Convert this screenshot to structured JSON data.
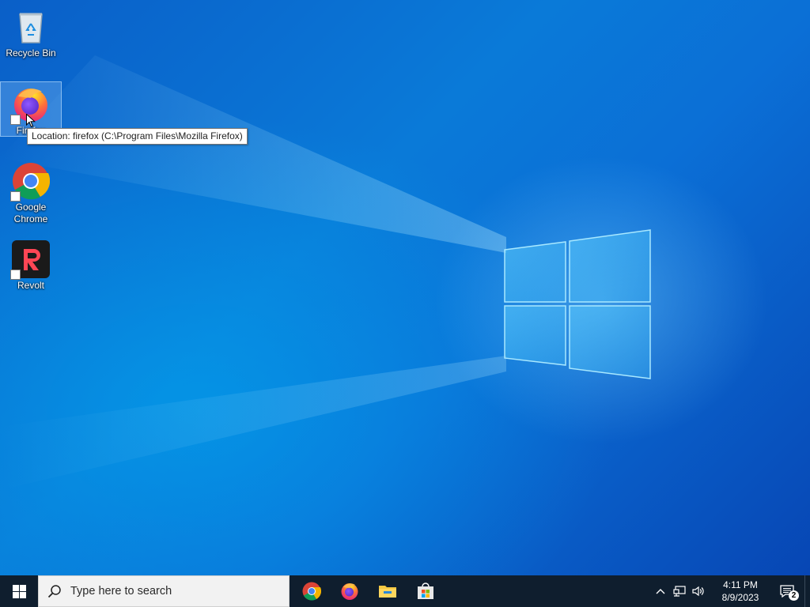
{
  "desktop": {
    "icons": [
      {
        "label": "Recycle Bin",
        "icon": "recycle-bin-icon"
      },
      {
        "label": "Firefox",
        "icon": "firefox-icon",
        "selected": true
      },
      {
        "label": "Google Chrome",
        "icon": "chrome-icon"
      },
      {
        "label": "Revolt",
        "icon": "revolt-icon"
      }
    ],
    "tooltip": "Location: firefox (C:\\Program Files\\Mozilla Firefox)"
  },
  "taskbar": {
    "search_placeholder": "Type here to search",
    "pinned": [
      {
        "name": "Google Chrome",
        "icon": "chrome-icon"
      },
      {
        "name": "Firefox",
        "icon": "firefox-icon"
      },
      {
        "name": "File Explorer",
        "icon": "folder-icon"
      },
      {
        "name": "Microsoft Store",
        "icon": "store-icon"
      }
    ],
    "tray": {
      "time": "4:11 PM",
      "date": "8/9/2023",
      "notification_count": "2"
    }
  },
  "colors": {
    "taskbar": "#0f1e2e",
    "wallpaper_primary": "#0a6fd6",
    "revolt_red": "#ff4655"
  }
}
